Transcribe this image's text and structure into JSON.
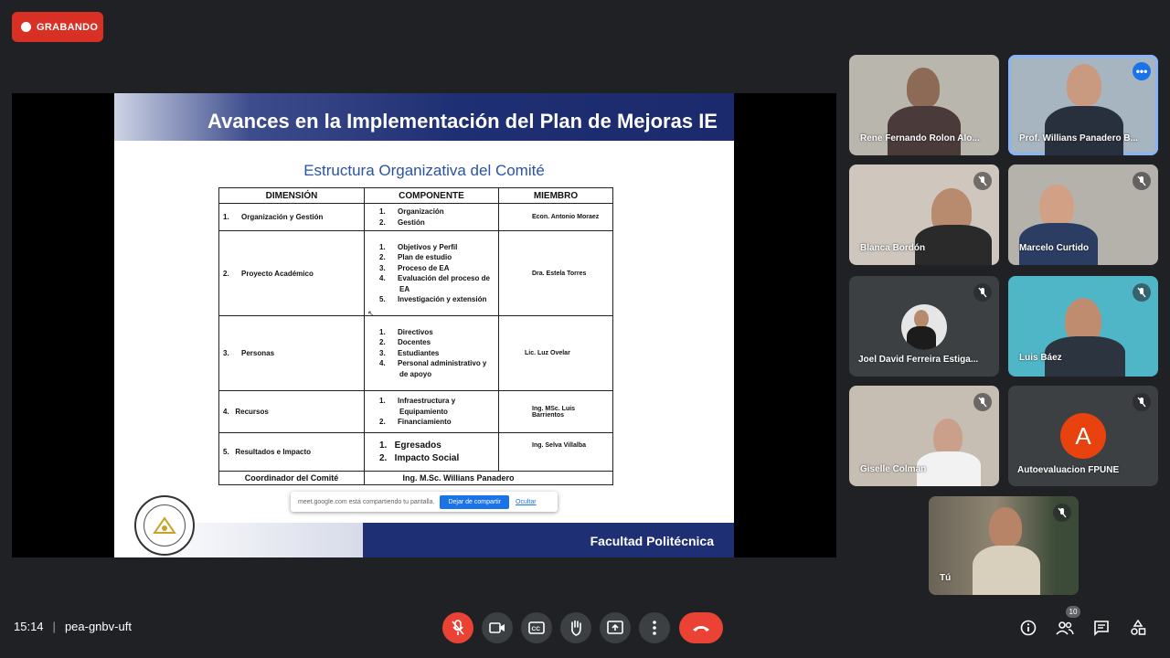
{
  "recording": {
    "label": "GRABANDO"
  },
  "slide": {
    "title": "Avances en la Implementación del Plan de Mejoras IE",
    "subtitle": "Estructura Organizativa del Comité",
    "footer": "Facultad Politécnica",
    "table": {
      "headers": [
        "DIMENSIÓN",
        "COMPONENTE",
        "MIEMBRO"
      ],
      "rows": [
        {
          "dimension": "1.      Organización y Gestión",
          "components": [
            "1.      Organización",
            "2.      Gestión"
          ],
          "member": "Econ. Antonio Moraez"
        },
        {
          "dimension": "2.      Proyecto Académico",
          "components": [
            "1.      Objetivos y Perfil",
            "2.      Plan de estudio",
            "3.      Proceso de EA",
            "4.      Evaluación del proceso de EA",
            "5.      Investigación y extensión"
          ],
          "member": "Dra. Estela Torres"
        },
        {
          "dimension": "3.      Personas",
          "components": [
            "1.      Directivos",
            "2.      Docentes",
            "3.      Estudiantes",
            "4.      Personal administrativo y de apoyo"
          ],
          "member": "Lic. Luz Ovelar"
        },
        {
          "dimension": "4.   Recursos",
          "components": [
            "1.      Infraestructura y Equipamiento",
            "2.      Financiamiento"
          ],
          "member": "Ing. MSc. Luis Barrientos"
        },
        {
          "dimension": "5.   Resultados e Impacto",
          "components": [
            "1.   Egresados",
            "2.   Impacto Social"
          ],
          "member": "Ing. Selva Villalba"
        }
      ],
      "footer_left": "Coordinador del Comité",
      "footer_right": "Ing. M.Sc. Willians Panadero"
    }
  },
  "share_bar": {
    "message": "meet.google.com está compartiendo tu pantalla.",
    "stop_label": "Dejar de compartir",
    "hide_label": "Ocultar"
  },
  "participants": [
    {
      "name": "Rene Fernando Rolon Alo...",
      "muted": false
    },
    {
      "name": "Prof. Willians Panadero B...",
      "muted": false,
      "active": true
    },
    {
      "name": "Blanca Bordón",
      "muted": true
    },
    {
      "name": "Marcelo Curtido",
      "muted": true
    },
    {
      "name": "Joel David Ferreira Estiga...",
      "muted": true
    },
    {
      "name": "Luis Báez",
      "muted": true
    },
    {
      "name": "Giselle Colman",
      "muted": true
    },
    {
      "name": "Autoevaluacion FPUNE",
      "muted": true,
      "avatar_letter": "A"
    },
    {
      "name": "Tú",
      "muted": true
    }
  ],
  "bottom_bar": {
    "time": "15:14",
    "meeting_code": "pea-gnbv-uft",
    "participant_count": "10"
  },
  "colors": {
    "background": "#202124",
    "recording": "#d93025",
    "end_call": "#ea4335",
    "avatar_A": "#e8430e",
    "active_border": "#8ab4f8"
  }
}
